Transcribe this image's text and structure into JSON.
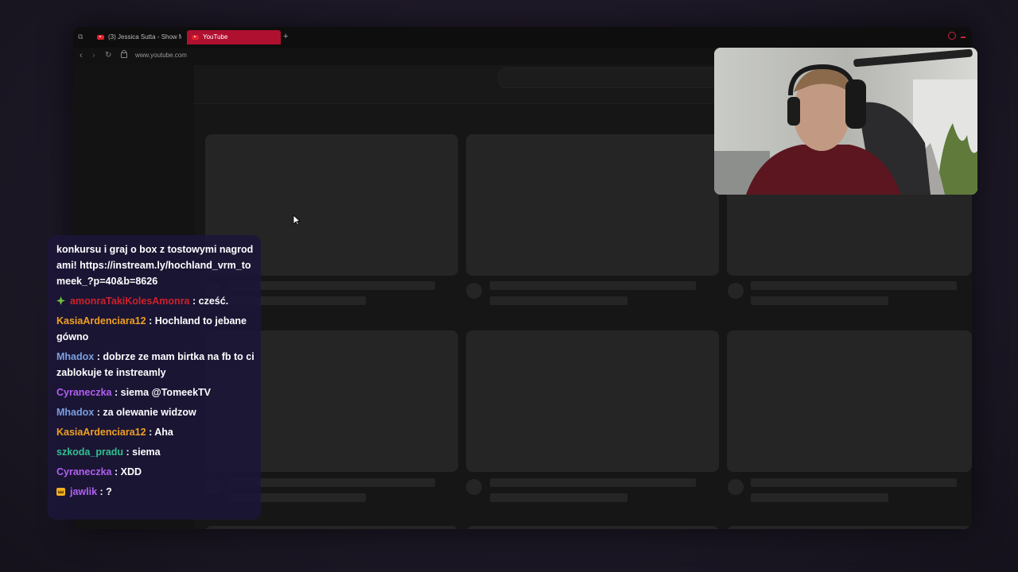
{
  "browser": {
    "tabs": [
      {
        "label": "(3) Jessica Sutta - Show M",
        "active": false
      },
      {
        "label": "YouTube",
        "active": true
      }
    ],
    "new_tab": "+",
    "url": "www.youtube.com",
    "accent_color": "#b01030"
  },
  "youtube": {
    "state": "loading-skeleton",
    "skeleton_color": "#252525"
  },
  "chat": {
    "background": "#1c1637",
    "messages": [
      {
        "user": "",
        "color": "#ffffff",
        "badge": "",
        "text": "konkursu i graj o box z tostowymi nagrodami! https://instream.ly/hochland_vrm_tomeek_?p=40&b=8626"
      },
      {
        "user": "amonraTakiKolesAmonra",
        "color": "#d0202a",
        "badge": "leaf-icon",
        "text": ": cześć."
      },
      {
        "user": "KasiaArdenciara12",
        "color": "#f0a020",
        "badge": "",
        "text": ": Hochland to jebane gówno"
      },
      {
        "user": "Mhadox",
        "color": "#7aa0e0",
        "badge": "",
        "text": ": dobrze ze mam birtka na fb to ci zablokuje te instreamly"
      },
      {
        "user": "Cyraneczka",
        "color": "#b060f0",
        "badge": "",
        "text": ": siema @TomeekTV"
      },
      {
        "user": "Mhadox",
        "color": "#7aa0e0",
        "badge": "",
        "text": ": za olewanie widzow"
      },
      {
        "user": "KasiaArdenciara12",
        "color": "#f0a020",
        "badge": "",
        "text": ": Aha"
      },
      {
        "user": "szkoda_pradu",
        "color": "#30c090",
        "badge": "",
        "text": ": siema"
      },
      {
        "user": "Cyraneczka",
        "color": "#b060f0",
        "badge": "",
        "text": ": XDD"
      },
      {
        "user": "jawlik",
        "color": "#b060f0",
        "badge": "crown-icon",
        "text": ": ?"
      }
    ]
  }
}
